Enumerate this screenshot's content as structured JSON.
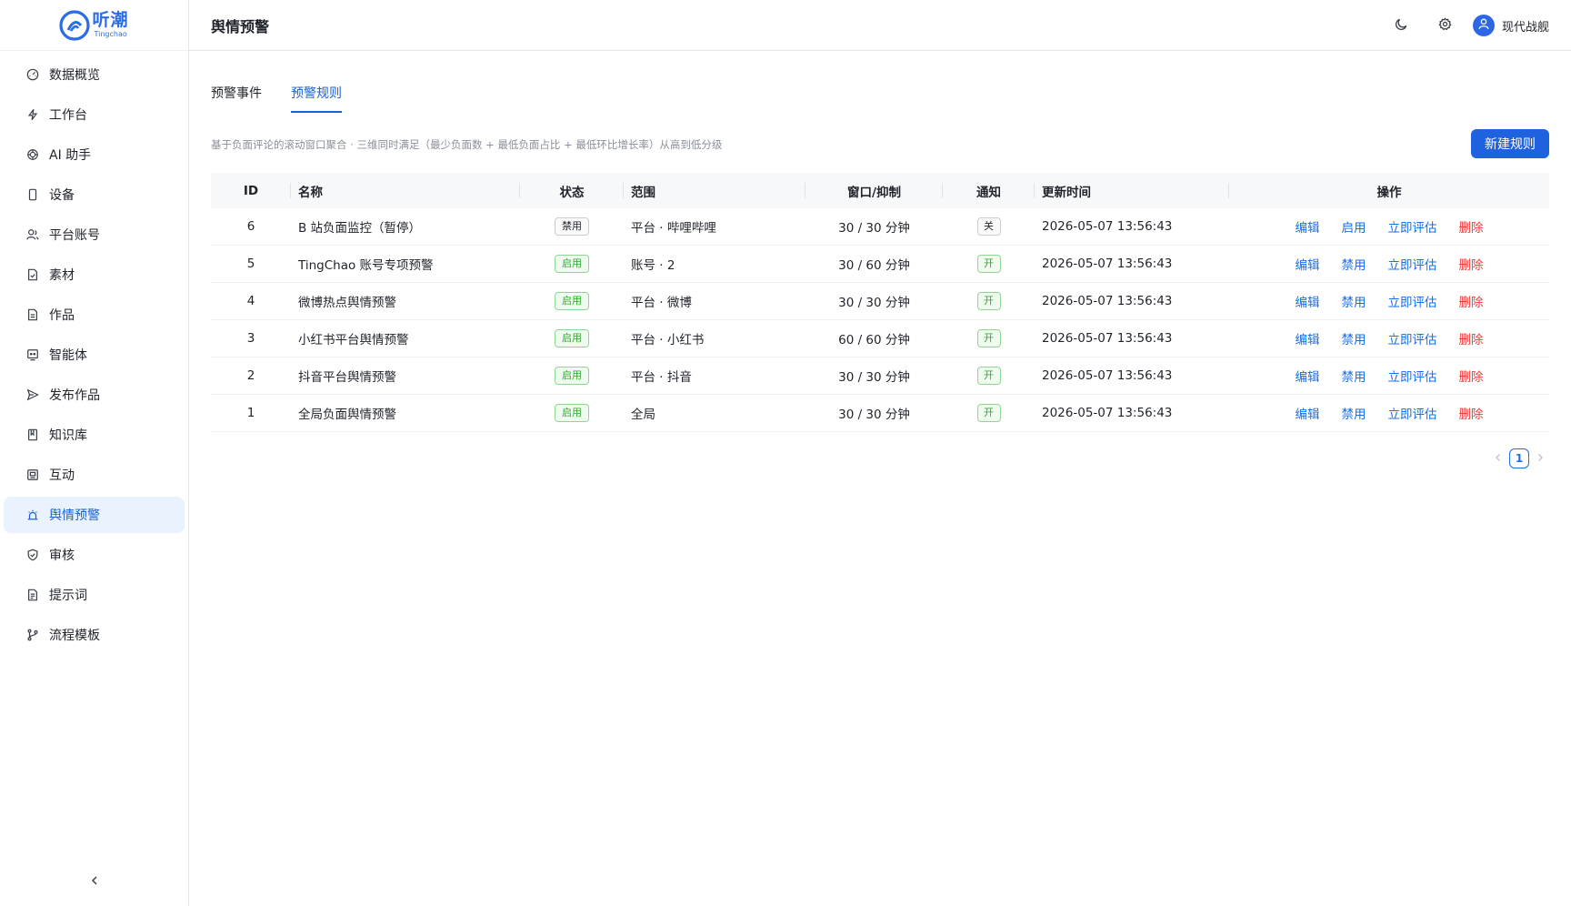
{
  "app": {
    "logo_cn": "听潮",
    "logo_en": "Tingchao"
  },
  "sidebar": {
    "items": [
      {
        "label": "数据概览",
        "icon": "dashboard-icon"
      },
      {
        "label": "工作台",
        "icon": "bolt-icon"
      },
      {
        "label": "AI 助手",
        "icon": "ai-icon"
      },
      {
        "label": "设备",
        "icon": "device-icon"
      },
      {
        "label": "平台账号",
        "icon": "accounts-icon"
      },
      {
        "label": "素材",
        "icon": "material-icon"
      },
      {
        "label": "作品",
        "icon": "works-icon"
      },
      {
        "label": "智能体",
        "icon": "agent-icon"
      },
      {
        "label": "发布作品",
        "icon": "publish-icon"
      },
      {
        "label": "知识库",
        "icon": "book-icon"
      },
      {
        "label": "互动",
        "icon": "interact-icon"
      },
      {
        "label": "舆情预警",
        "icon": "alarm-icon",
        "active": true
      },
      {
        "label": "审核",
        "icon": "shield-icon"
      },
      {
        "label": "提示词",
        "icon": "prompt-icon"
      },
      {
        "label": "流程模板",
        "icon": "branch-icon"
      }
    ]
  },
  "header": {
    "title": "舆情预警",
    "user_name": "现代战舰"
  },
  "tabs": [
    {
      "label": "预警事件"
    },
    {
      "label": "预警规则",
      "active": true
    }
  ],
  "description": "基于负面评论的滚动窗口聚合 · 三维同时满足（最少负面数 + 最低负面占比 + 最低环比增长率）从高到低分级",
  "new_button_label": "新建规则",
  "table": {
    "columns": {
      "id": "ID",
      "name": "名称",
      "status": "状态",
      "range": "范围",
      "window": "窗口/抑制",
      "notify": "通知",
      "time": "更新时间",
      "ops": "操作"
    },
    "rows": [
      {
        "id": "6",
        "name": "B 站负面监控（暂停）",
        "status": "禁用",
        "status_on": false,
        "range": "平台 · 哔哩哔哩",
        "window": "30 / 30 分钟",
        "notify": "关",
        "notify_on": false,
        "time": "2026-05-07 13:56:43",
        "ops": {
          "edit": "编辑",
          "toggle": "启用",
          "eval": "立即评估",
          "delete": "删除"
        }
      },
      {
        "id": "5",
        "name": "TingChao 账号专项预警",
        "status": "启用",
        "status_on": true,
        "range": "账号 · 2",
        "window": "30 / 60 分钟",
        "notify": "开",
        "notify_on": true,
        "time": "2026-05-07 13:56:43",
        "ops": {
          "edit": "编辑",
          "toggle": "禁用",
          "eval": "立即评估",
          "delete": "删除"
        }
      },
      {
        "id": "4",
        "name": "微博热点舆情预警",
        "status": "启用",
        "status_on": true,
        "range": "平台 · 微博",
        "window": "30 / 30 分钟",
        "notify": "开",
        "notify_on": true,
        "time": "2026-05-07 13:56:43",
        "ops": {
          "edit": "编辑",
          "toggle": "禁用",
          "eval": "立即评估",
          "delete": "删除"
        }
      },
      {
        "id": "3",
        "name": "小红书平台舆情预警",
        "status": "启用",
        "status_on": true,
        "range": "平台 · 小红书",
        "window": "60 / 60 分钟",
        "notify": "开",
        "notify_on": true,
        "time": "2026-05-07 13:56:43",
        "ops": {
          "edit": "编辑",
          "toggle": "禁用",
          "eval": "立即评估",
          "delete": "删除"
        }
      },
      {
        "id": "2",
        "name": "抖音平台舆情预警",
        "status": "启用",
        "status_on": true,
        "range": "平台 · 抖音",
        "window": "30 / 30 分钟",
        "notify": "开",
        "notify_on": true,
        "time": "2026-05-07 13:56:43",
        "ops": {
          "edit": "编辑",
          "toggle": "禁用",
          "eval": "立即评估",
          "delete": "删除"
        }
      },
      {
        "id": "1",
        "name": "全局负面舆情预警",
        "status": "启用",
        "status_on": true,
        "range": "全局",
        "window": "30 / 30 分钟",
        "notify": "开",
        "notify_on": true,
        "time": "2026-05-07 13:56:43",
        "ops": {
          "edit": "编辑",
          "toggle": "禁用",
          "eval": "立即评估",
          "delete": "删除"
        }
      }
    ]
  },
  "pagination": {
    "current": "1"
  },
  "colors": {
    "accent": "#1f62e0",
    "link": "#1a6ee8",
    "danger": "#f23c3c",
    "success": "#2fa82f",
    "active_bg": "#eaf2fe"
  }
}
